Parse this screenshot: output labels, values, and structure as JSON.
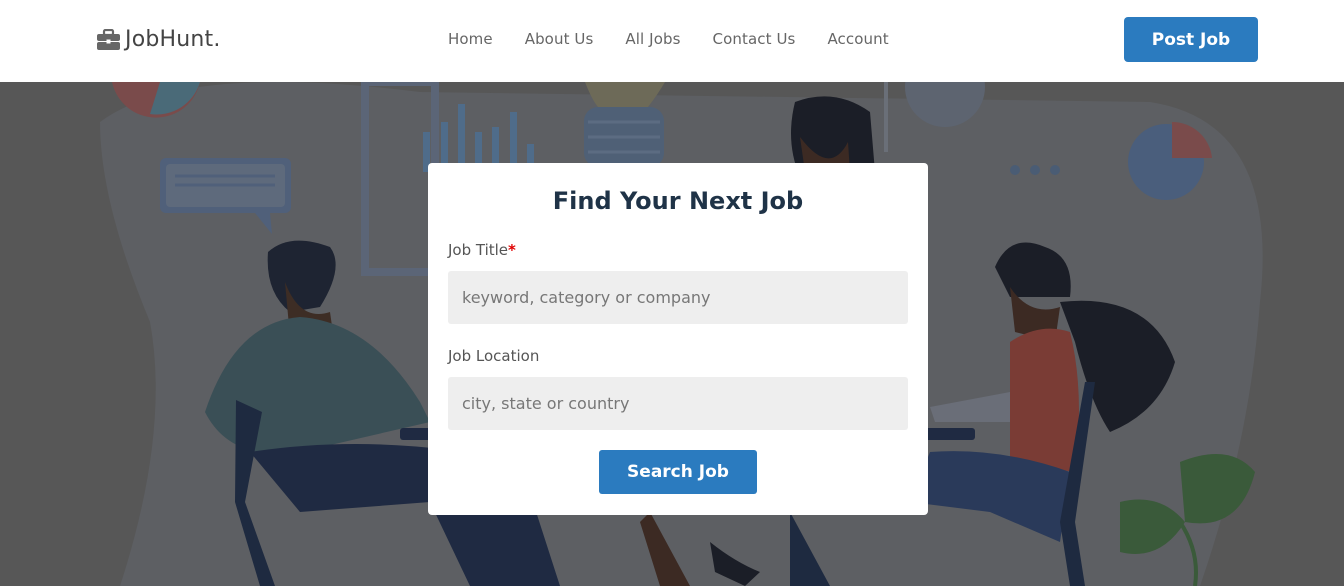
{
  "header": {
    "logo_icon": "briefcase-icon",
    "logo_text": "JobHunt.",
    "nav": [
      {
        "label": "Home"
      },
      {
        "label": "About Us"
      },
      {
        "label": "All Jobs"
      },
      {
        "label": "Contact Us"
      },
      {
        "label": "Account"
      }
    ],
    "post_job_label": "Post Job"
  },
  "search_card": {
    "title": "Find Your Next Job",
    "job_title_label": "Job Title",
    "required_marker": "*",
    "job_title_placeholder": "keyword, category or company",
    "job_location_label": "Job Location",
    "job_location_placeholder": "city, state or country",
    "search_button_label": "Search Job"
  },
  "colors": {
    "accent": "#2b7bbf",
    "overlay": "#555555",
    "required": "#e00000"
  }
}
